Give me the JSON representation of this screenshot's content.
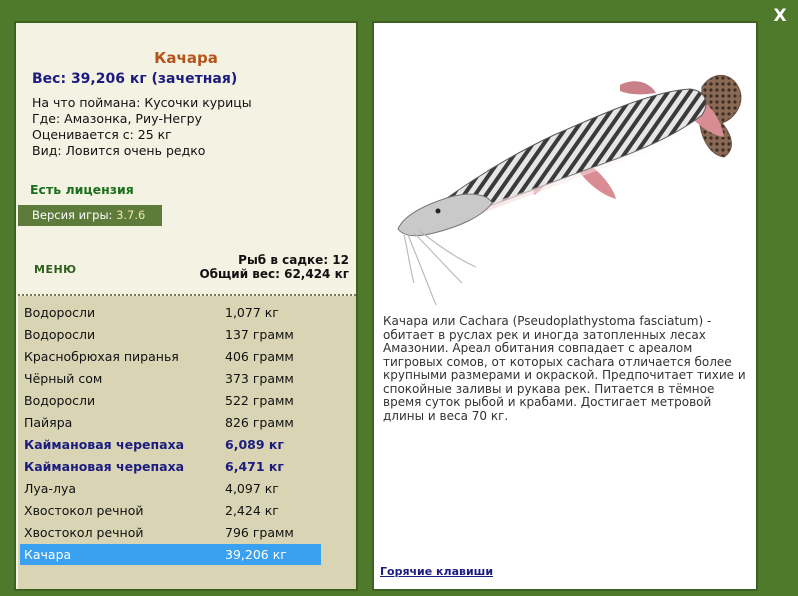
{
  "close_label": "X",
  "fish": {
    "name": "Качара",
    "weight": "Вес: 39,206 кг (зачетная)",
    "bait": "На что поймана: Кусочки курицы",
    "location": "Где: Амазонка, Риу-Негру",
    "value": "Оценивается с: 25 кг",
    "rarity": "Вид: Ловится очень редко"
  },
  "license": "Есть лицензия",
  "version": {
    "label": "Версия игры:",
    "value": "3.7.6"
  },
  "menu_label": "МЕНЮ",
  "stats": {
    "count": "Рыб в садке: 12",
    "total": "Общий вес: 62,424 кг"
  },
  "catch_list": [
    {
      "name": "Водоросли",
      "weight": "1,077 кг"
    },
    {
      "name": "Водоросли",
      "weight": "137 грамм"
    },
    {
      "name": "Краснобрюхая пиранья",
      "weight": "406 грамм"
    },
    {
      "name": "Чёрный сом",
      "weight": "373 грамм"
    },
    {
      "name": "Водоросли",
      "weight": "522 грамм"
    },
    {
      "name": "Пайяра",
      "weight": "826 грамм"
    },
    {
      "name": "Каймановая черепаха",
      "weight": "6,089 кг"
    },
    {
      "name": "Каймановая черепаха",
      "weight": "6,471 кг"
    },
    {
      "name": "Луа-луа",
      "weight": "4,097 кг"
    },
    {
      "name": "Хвостокол речной",
      "weight": "2,424 кг"
    },
    {
      "name": "Хвостокол речной",
      "weight": "796 грамм"
    },
    {
      "name": "Качара",
      "weight": "39,206 кг"
    }
  ],
  "description": "Качара или Cachara (Pseudoplathystoma fasciatum) - обитает в руслах рек и иногда затопленных лесах Амазонии. Ареал обитания совпадает с ареалом тигровых сомов, от которых cachara отличается более крупными размерами и окраской. Предпочитает тихие и спокойные заливы и рукава рек. Питается в тёмное время суток рыбой и крабами. Достигает метровой длины и веса 70 кг.",
  "hotkeys_label": "Горячие клавиши",
  "colors": {
    "window_bg": "#4f7a2c",
    "panel_bg": "#f4f2e2",
    "list_bg": "#d9d5b4",
    "selection": "#3aa0f0",
    "title": "#b5541a",
    "accent_text": "#1c1c80",
    "license_text": "#1d6e1d"
  }
}
